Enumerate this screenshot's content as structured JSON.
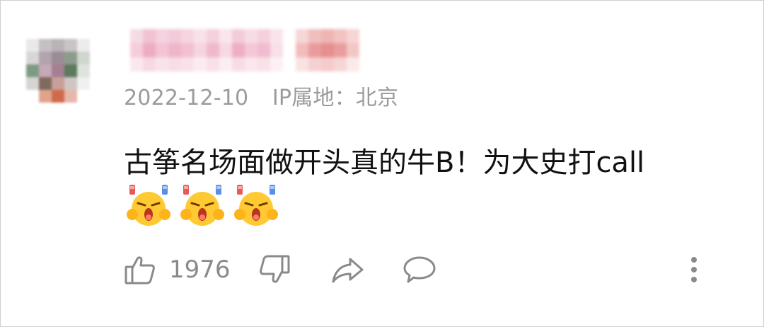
{
  "comment": {
    "date": "2022-12-10",
    "ip_location": "IP属地：北京",
    "text": "古筝名场面做开头真的牛B！为大史打call",
    "emojis": [
      "call-cheer-emoji",
      "call-cheer-emoji",
      "call-cheer-emoji"
    ]
  },
  "actions": {
    "like_count": "1976",
    "icons": [
      "thumbs-up-icon",
      "thumbs-down-icon",
      "share-icon",
      "comment-icon",
      "more-vertical-icon"
    ]
  },
  "colors": {
    "meta_text": "#9b9b9b",
    "body_text": "#111111",
    "icon": "#8a8a8a"
  }
}
